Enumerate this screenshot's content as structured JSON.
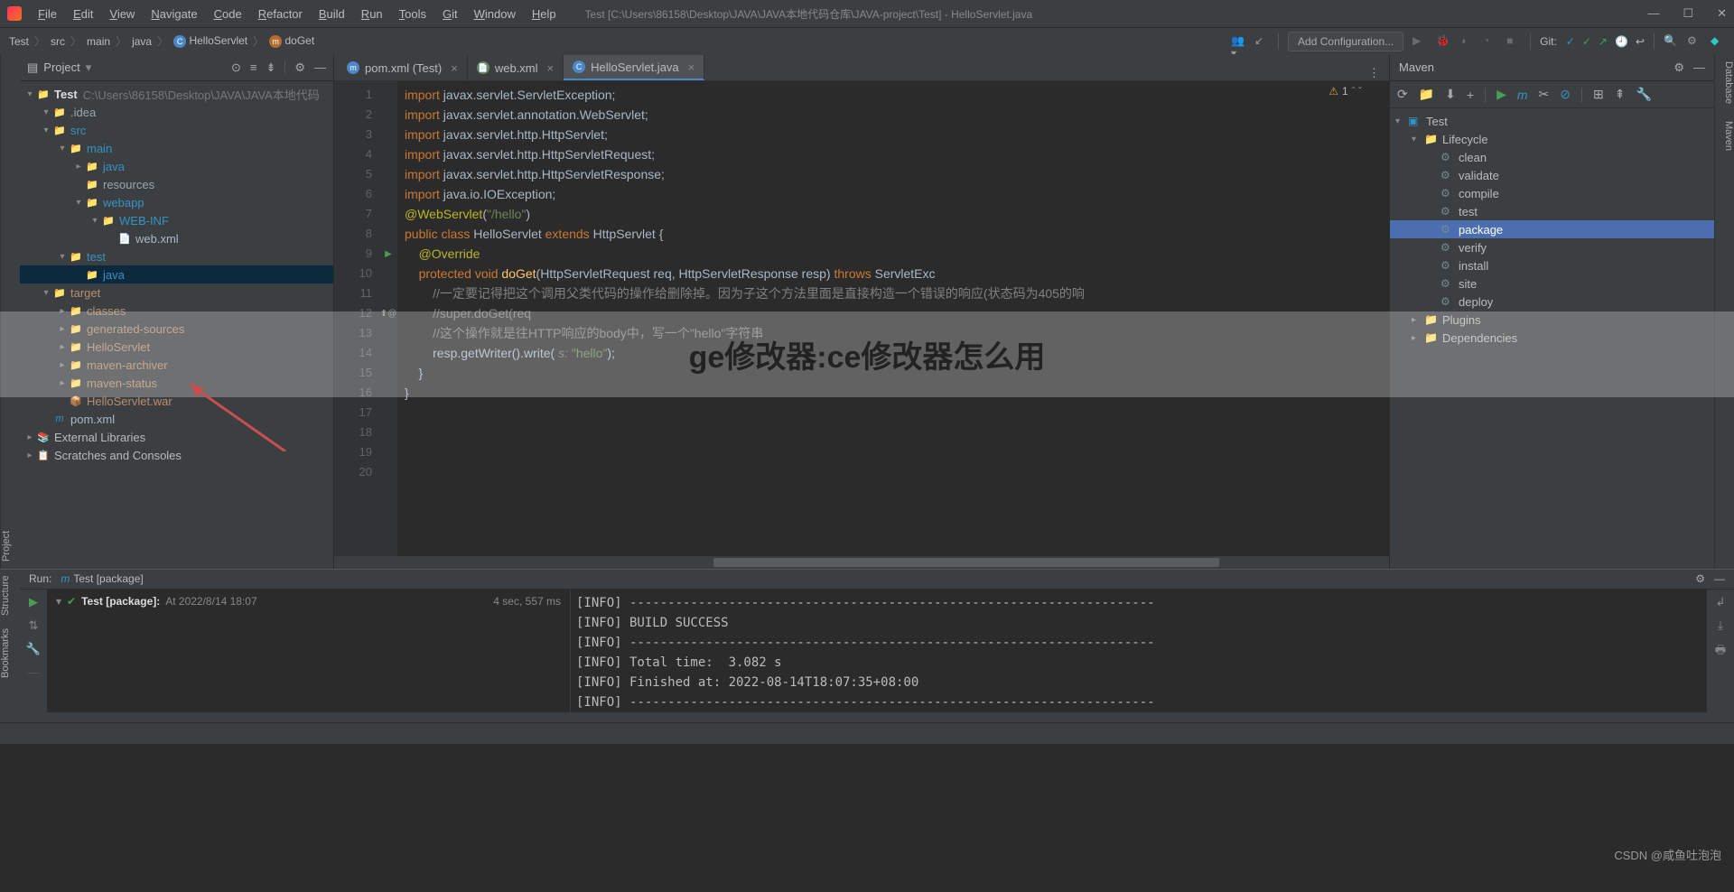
{
  "titlebar": {
    "menus": [
      "File",
      "Edit",
      "View",
      "Navigate",
      "Code",
      "Refactor",
      "Build",
      "Run",
      "Tools",
      "Git",
      "Window",
      "Help"
    ],
    "path": "Test [C:\\Users\\86158\\Desktop\\JAVA\\JAVA本地代码仓库\\JAVA-project\\Test] - HelloServlet.java"
  },
  "breadcrumb": [
    "Test",
    "src",
    "main",
    "java",
    "HelloServlet",
    "doGet"
  ],
  "runConfig": "Add Configuration...",
  "gitLabel": "Git:",
  "projectPanel": {
    "title": "Project",
    "rootName": "Test",
    "rootPath": "C:\\Users\\86158\\Desktop\\JAVA\\JAVA本地代码",
    "tree": [
      {
        "d": 1,
        "arr": "▾",
        "icon": "📁",
        "cls": "folder",
        "label": ".idea"
      },
      {
        "d": 1,
        "arr": "▾",
        "icon": "📁",
        "cls": "folder-blue",
        "label": "src"
      },
      {
        "d": 2,
        "arr": "▾",
        "icon": "📁",
        "cls": "folder-blue",
        "label": "main"
      },
      {
        "d": 3,
        "arr": "▸",
        "icon": "📁",
        "cls": "folder-blue",
        "label": "java"
      },
      {
        "d": 3,
        "arr": "",
        "icon": "📁",
        "cls": "folder",
        "label": "resources"
      },
      {
        "d": 3,
        "arr": "▾",
        "icon": "📁",
        "cls": "folder-blue",
        "label": "webapp"
      },
      {
        "d": 4,
        "arr": "▾",
        "icon": "📁",
        "cls": "folder-blue",
        "label": "WEB-INF"
      },
      {
        "d": 5,
        "arr": "",
        "icon": "📄",
        "cls": "file-xml",
        "label": "web.xml"
      },
      {
        "d": 2,
        "arr": "▾",
        "icon": "📁",
        "cls": "folder-blue",
        "label": "test"
      },
      {
        "d": 3,
        "arr": "",
        "icon": "📁",
        "cls": "folder-blue",
        "label": "java",
        "sel": true
      },
      {
        "d": 1,
        "arr": "▾",
        "icon": "📁",
        "cls": "folder-orange",
        "label": "target"
      },
      {
        "d": 2,
        "arr": "▸",
        "icon": "📁",
        "cls": "folder-orange",
        "label": "classes"
      },
      {
        "d": 2,
        "arr": "▸",
        "icon": "📁",
        "cls": "folder-orange",
        "label": "generated-sources"
      },
      {
        "d": 2,
        "arr": "▸",
        "icon": "📁",
        "cls": "folder-orange",
        "label": "HelloServlet"
      },
      {
        "d": 2,
        "arr": "▸",
        "icon": "📁",
        "cls": "folder-orange",
        "label": "maven-archiver"
      },
      {
        "d": 2,
        "arr": "▸",
        "icon": "📁",
        "cls": "folder-orange",
        "label": "maven-status"
      },
      {
        "d": 2,
        "arr": "",
        "icon": "📦",
        "cls": "folder-orange",
        "label": "HelloServlet.war"
      },
      {
        "d": 1,
        "arr": "",
        "icon": "m",
        "cls": "file-xml",
        "label": "pom.xml"
      }
    ],
    "externalLibs": "External Libraries",
    "scratches": "Scratches and Consoles"
  },
  "tabs": [
    {
      "icon": "m",
      "iconColor": "#4a88c7",
      "label": "pom.xml (Test)",
      "active": false
    },
    {
      "icon": "📄",
      "iconColor": "#6a8759",
      "label": "web.xml",
      "active": false
    },
    {
      "icon": "C",
      "iconColor": "#4a88c7",
      "label": "HelloServlet.java",
      "active": true
    }
  ],
  "editor": {
    "warnCount": "1",
    "lines": [
      {
        "n": 1,
        "html": "<span class='kw'>import</span> javax.servlet.ServletException;"
      },
      {
        "n": 2,
        "html": "<span class='kw'>import</span> javax.servlet.annotation.<span class='cls'>WebServlet</span>;"
      },
      {
        "n": 3,
        "html": "<span class='kw'>import</span> javax.servlet.http.HttpServlet;"
      },
      {
        "n": 4,
        "html": "<span class='kw'>import</span> javax.servlet.http.HttpServletRequest;"
      },
      {
        "n": 5,
        "html": "<span class='kw'>import</span> javax.servlet.http.HttpServletResponse;"
      },
      {
        "n": 6,
        "html": "<span class='kw'>import</span> java.io.IOException;"
      },
      {
        "n": 7,
        "html": ""
      },
      {
        "n": 8,
        "html": "<span class='ann'>@WebServlet</span>(<span class='str'>\"/hello\"</span>)"
      },
      {
        "n": 9,
        "html": "<span class='kw'>public class</span> HelloServlet <span class='kw'>extends</span> HttpServlet {"
      },
      {
        "n": 10,
        "html": ""
      },
      {
        "n": 11,
        "html": "    <span class='ann'>@Override</span>"
      },
      {
        "n": 12,
        "html": "    <span class='kw'>protected void</span> <span style='color:#ffc66d'>doGet</span>(HttpServletRequest req, HttpServletResponse resp) <span class='kw'>throws</span> ServletExc"
      },
      {
        "n": 13,
        "html": "        <span class='cmt'>//一定要记得把这个调用父类代码的操作给删除掉。因为子这个方法里面是直接构造一个错误的响应(状态码为405的响</span>"
      },
      {
        "n": 14,
        "html": "        <span class='cmt'>//super.doGet(req</span>"
      },
      {
        "n": 15,
        "html": ""
      },
      {
        "n": 16,
        "html": "        <span class='cmt'>//这个操作就是往HTTP响应的body中，写一个\"hello\"字符串</span>"
      },
      {
        "n": 17,
        "html": "        resp.getWriter().write( <span class='param'>s:</span> <span class='str'>\"hello\"</span>);"
      },
      {
        "n": 18,
        "html": "    }"
      },
      {
        "n": 19,
        "html": "}"
      },
      {
        "n": 20,
        "html": ""
      }
    ]
  },
  "maven": {
    "title": "Maven",
    "root": "Test",
    "lifecycle": "Lifecycle",
    "goals": [
      "clean",
      "validate",
      "compile",
      "test",
      "package",
      "verify",
      "install",
      "site",
      "deploy"
    ],
    "selected": "package",
    "plugins": "Plugins",
    "dependencies": "Dependencies"
  },
  "run": {
    "label": "Run:",
    "config": "Test [package]",
    "treeItem": "Test [package]:",
    "treeTime": "At 2022/8/14 18:07",
    "duration": "4 sec, 557 ms",
    "console": [
      "[INFO] ---------------------------------------------------------------------",
      "[INFO] BUILD SUCCESS",
      "[INFO] ---------------------------------------------------------------------",
      "[INFO] Total time:  3.082 s",
      "[INFO] Finished at: 2022-08-14T18:07:35+08:00",
      "[INFO] ---------------------------------------------------------------------"
    ]
  },
  "leftTabs": [
    "Project"
  ],
  "leftBottomTabs": [
    "Structure",
    "Bookmarks"
  ],
  "rightTabs": [
    "Database",
    "Maven"
  ],
  "overlay": "ge修改器:ce修改器怎么用",
  "watermark": "CSDN @咸鱼吐泡泡"
}
